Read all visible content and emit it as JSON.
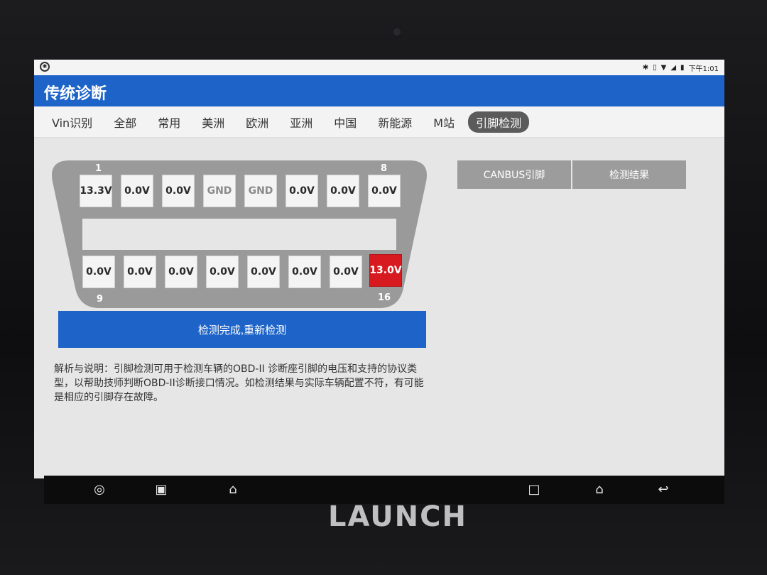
{
  "device": {
    "brand": "LAUNCH"
  },
  "status_bar": {
    "time": "下午1:01"
  },
  "app": {
    "title": "传统诊断"
  },
  "tabs": [
    {
      "label": "Vin识别"
    },
    {
      "label": "全部"
    },
    {
      "label": "常用"
    },
    {
      "label": "美洲"
    },
    {
      "label": "欧洲"
    },
    {
      "label": "亚洲"
    },
    {
      "label": "中国"
    },
    {
      "label": "新能源"
    },
    {
      "label": "M站"
    },
    {
      "label": "引脚检测",
      "active": true
    }
  ],
  "connector": {
    "pin_label_1": "1",
    "pin_label_8": "8",
    "pin_label_9": "9",
    "pin_label_16": "16",
    "top_row": [
      "13.3V",
      "0.0V",
      "0.0V",
      "GND",
      "GND",
      "0.0V",
      "0.0V",
      "0.0V"
    ],
    "bottom_row": [
      "0.0V",
      "0.0V",
      "0.0V",
      "0.0V",
      "0.0V",
      "0.0V",
      "0.0V",
      "13.0V"
    ],
    "alert_color": "#d71920"
  },
  "actions": {
    "retest_label": "检测完成,重新检测"
  },
  "note": {
    "text": "解析与说明：引脚检测可用于检测车辆的OBD-II 诊断座引脚的电压和支持的协议类型，以帮助技师判断OBD-II诊断接口情况。如检测结果与实际车辆配置不符，有可能是相应的引脚存在故障。"
  },
  "result_tabs": {
    "canbus_label": "CANBUS引脚",
    "result_label": "检测结果"
  },
  "colors": {
    "accent": "#1e64c8",
    "active_tab": "#5b5b5b"
  },
  "navigation": {
    "icons": [
      "orbit-icon",
      "gallery-icon",
      "vci-icon",
      "recents-icon",
      "home-icon",
      "back-icon"
    ]
  }
}
